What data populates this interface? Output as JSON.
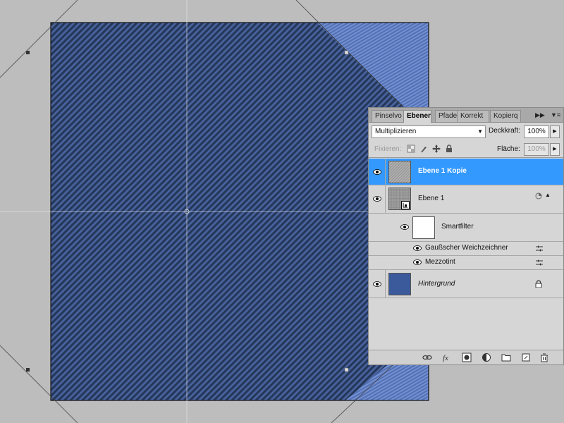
{
  "layers_panel": {
    "tabs": [
      {
        "label": "Pinselvo",
        "active": false
      },
      {
        "label": "Ebenen",
        "active": true
      },
      {
        "label": "Pfade",
        "active": false
      },
      {
        "label": "Korrekt",
        "active": false
      },
      {
        "label": "Kopierq",
        "active": false
      }
    ],
    "blend_mode": "Multiplizieren",
    "opacity_label": "Deckkraft:",
    "opacity_value": "100%",
    "lock_label": "Fixieren:",
    "fill_label": "Fläche:",
    "fill_value": "100%",
    "layers": [
      {
        "name": "Ebene 1 Kopie",
        "selected": true
      },
      {
        "name": "Ebene 1",
        "selected": false
      },
      {
        "name": "Smartfilter",
        "selected": false
      },
      {
        "name": "Gaußscher Weichzeichner",
        "selected": false
      },
      {
        "name": "Mezzotint",
        "selected": false
      },
      {
        "name": "Hintergrund",
        "selected": false
      }
    ],
    "bottom_icons": [
      "link-icon",
      "fx-icon",
      "mask-icon",
      "adjustment-icon",
      "folder-icon",
      "new-layer-icon",
      "trash-icon"
    ]
  },
  "colors": {
    "canvas_bg": "#bdbdbd",
    "denim_dark": "#2b3f66",
    "denim_light": "#4b6aa8",
    "selection": "#3399ff",
    "hintergrund": "#3a5a9c"
  }
}
